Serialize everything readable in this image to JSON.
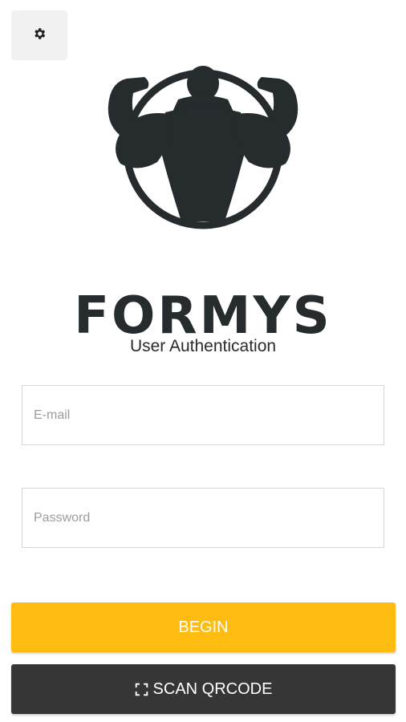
{
  "settings": {
    "icon": "gear-icon"
  },
  "logo": {
    "brand": "FORMYS",
    "icon": "bodybuilder-logo"
  },
  "auth": {
    "title": "User Authentication",
    "email_placeholder": "E-mail",
    "password_placeholder": "Password",
    "begin_label": "BEGIN",
    "scan_label": "SCAN QRCODE"
  },
  "colors": {
    "accent": "#fdbc0f",
    "dark_button": "#363636",
    "logo": "#262b2e"
  }
}
